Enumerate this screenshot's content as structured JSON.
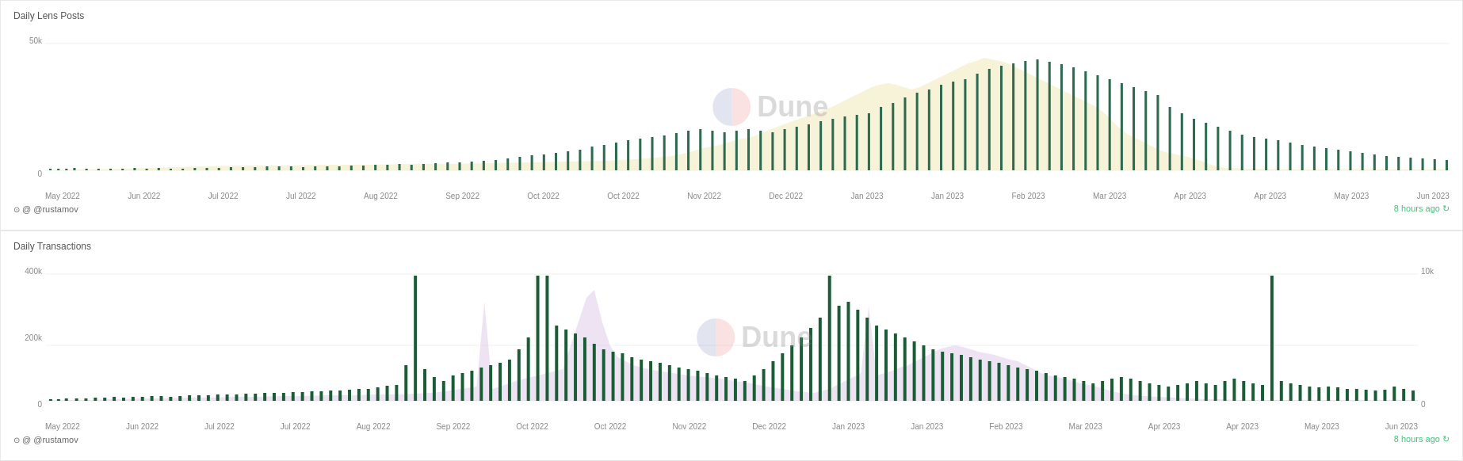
{
  "chart1": {
    "title": "Daily Lens Posts",
    "attribution": "@ @rustamov",
    "last_updated": "8 hours ago",
    "y_axis": {
      "top_label": "50k",
      "bottom_label": "0"
    },
    "x_labels": [
      "May 2022",
      "Jun 2022",
      "Jul 2022",
      "Jul 2022",
      "Aug 2022",
      "Sep 2022",
      "Oct 2022",
      "Oct 2022",
      "Nov 2022",
      "Dec 2022",
      "Jan 2023",
      "Jan 2023",
      "Feb 2023",
      "Mar 2023",
      "Apr 2023",
      "Apr 2023",
      "May 2023",
      "Jun 2023"
    ]
  },
  "chart2": {
    "title": "Daily Transactions",
    "attribution": "@ @rustamov",
    "last_updated": "8 hours ago",
    "y_axis": {
      "top_label": "400k",
      "mid_label": "200k",
      "bottom_label": "0"
    },
    "right_y_axis": {
      "top_label": "10k",
      "bottom_label": "0"
    },
    "x_labels": [
      "May 2022",
      "Jun 2022",
      "Jul 2022",
      "Jul 2022",
      "Aug 2022",
      "Sep 2022",
      "Oct 2022",
      "Oct 2022",
      "Nov 2022",
      "Dec 2022",
      "Jan 2023",
      "Jan 2023",
      "Feb 2023",
      "Mar 2023",
      "Apr 2023",
      "Apr 2023",
      "May 2023",
      "Jun 2023"
    ]
  },
  "icons": {
    "attribution_icon": "⊙",
    "refresh_icon": "↻"
  }
}
